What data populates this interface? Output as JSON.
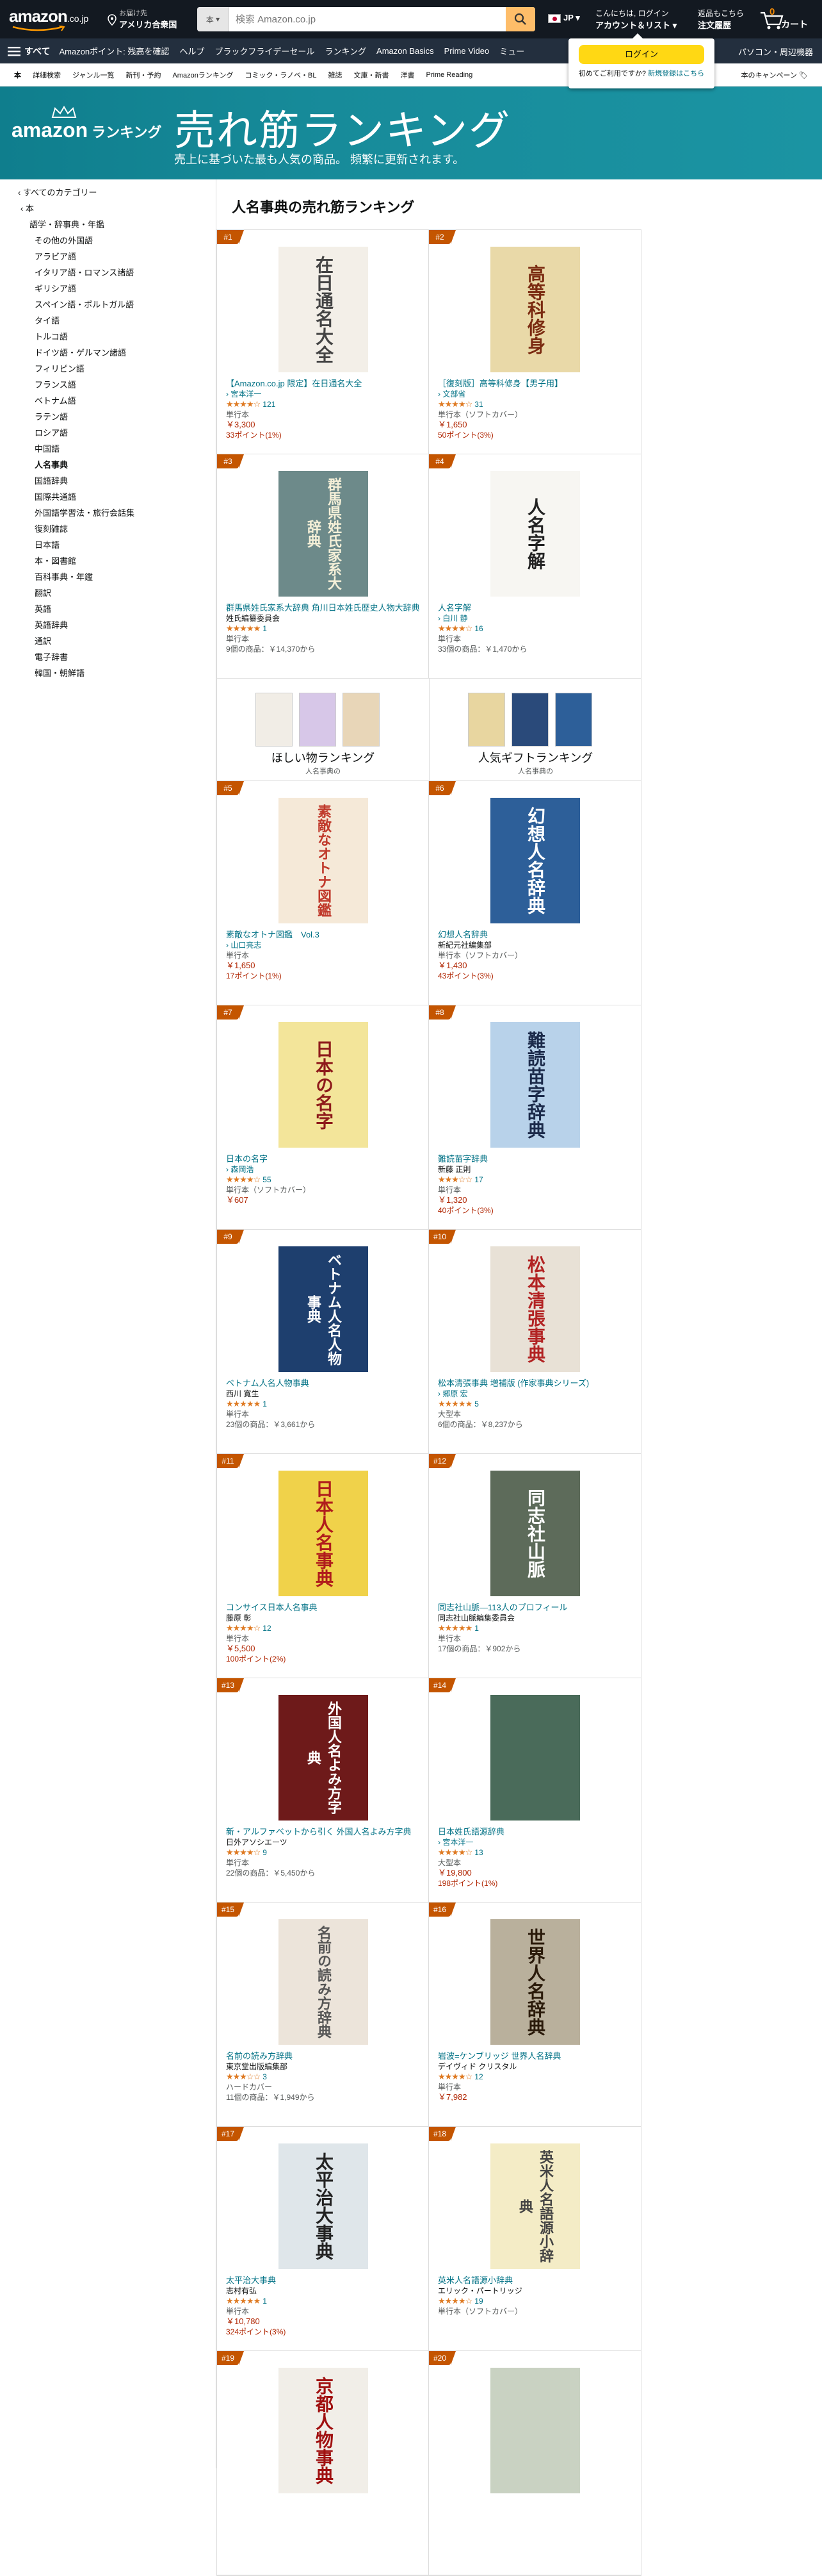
{
  "nav": {
    "logo": "amazon",
    "logo_suffix": ".co.jp",
    "deliver_l1": "お届け先",
    "deliver_l2": "アメリカ合衆国",
    "search_category": "本",
    "search_placeholder": "検索 Amazon.co.jp",
    "lang": "JP",
    "account_l1": "こんにちは, ログイン",
    "account_l2": "アカウント＆リスト",
    "orders_l1": "返品もこちら",
    "orders_l2": "注文履歴",
    "cart_count": "0",
    "cart_label": "カート"
  },
  "subnav": {
    "all": "すべて",
    "items": [
      "Amazonポイント: 残高を確認",
      "ヘルプ",
      "ブラックフライデーセール",
      "ランキング",
      "Amazon Basics",
      "Prime Video",
      "ミュー"
    ],
    "right": "パソコン・周辺機器"
  },
  "flyout": {
    "button": "ログイン",
    "text": "初めてご利用ですか?",
    "link": "新規登録はこちら"
  },
  "deptnav": {
    "items": [
      "本",
      "詳細検索",
      "ジャンル一覧",
      "新刊・予約",
      "Amazonランキング",
      "コミック・ラノベ・BL",
      "雑誌",
      "文庫・新書",
      "洋書",
      "Prime Reading"
    ],
    "right": "本のキャンペーン"
  },
  "banner": {
    "logo_word": "amazon",
    "logo_rank": "ランキング",
    "title": "売れ筋ランキング",
    "subtitle": "売上に基づいた最も人気の商品。 頻繁に更新されます。"
  },
  "sidebar": [
    {
      "label": "‹ すべてのカテゴリー",
      "d": 0
    },
    {
      "label": "‹ 本",
      "d": 1
    },
    {
      "label": "語学・辞事典・年鑑",
      "d": 2
    },
    {
      "label": "その他の外国語",
      "d": 3
    },
    {
      "label": "アラビア語",
      "d": 3
    },
    {
      "label": "イタリア語・ロマンス諸語",
      "d": 3
    },
    {
      "label": "ギリシア語",
      "d": 3
    },
    {
      "label": "スペイン語・ポルトガル語",
      "d": 3
    },
    {
      "label": "タイ語",
      "d": 3
    },
    {
      "label": "トルコ語",
      "d": 3
    },
    {
      "label": "ドイツ語・ゲルマン諸語",
      "d": 3
    },
    {
      "label": "フィリピン語",
      "d": 3
    },
    {
      "label": "フランス語",
      "d": 3
    },
    {
      "label": "ベトナム語",
      "d": 3
    },
    {
      "label": "ラテン語",
      "d": 3
    },
    {
      "label": "ロシア語",
      "d": 3
    },
    {
      "label": "中国語",
      "d": 3
    },
    {
      "label": "人名事典",
      "d": 3,
      "sel": true
    },
    {
      "label": "国語辞典",
      "d": 3
    },
    {
      "label": "国際共通語",
      "d": 3
    },
    {
      "label": "外国語学習法・旅行会話集",
      "d": 3
    },
    {
      "label": "復刻雑誌",
      "d": 3
    },
    {
      "label": "日本語",
      "d": 3
    },
    {
      "label": "本・図書館",
      "d": 3
    },
    {
      "label": "百科事典・年鑑",
      "d": 3
    },
    {
      "label": "翻訳",
      "d": 3
    },
    {
      "label": "英語",
      "d": 3
    },
    {
      "label": "英語辞典",
      "d": 3
    },
    {
      "label": "通訳",
      "d": 3
    },
    {
      "label": "電子辞書",
      "d": 3
    },
    {
      "label": "韓国・朝鮮語",
      "d": 3
    }
  ],
  "heading": "人名事典の売れ筋ランキング",
  "products": [
    {
      "rank": "#1",
      "title": "【Amazon.co.jp 限定】在日通名大全",
      "author": "› 宮本洋一",
      "author_link": true,
      "stars": "★★★★☆",
      "rating": 4.0,
      "count": "121",
      "format": "単行本",
      "price": "￥3,300",
      "points": "33ポイント(1%)",
      "offers": "",
      "cover_text": "在日通名大全",
      "cover_bg": "#f3efe8",
      "cover_fg": "#444"
    },
    {
      "rank": "#2",
      "title": "［復刻版］高等科修身【男子用】",
      "author": "› 文部省",
      "author_link": true,
      "stars": "★★★★☆",
      "rating": 4.4,
      "count": "31",
      "format": "単行本（ソフトカバー）",
      "price": "￥1,650",
      "points": "50ポイント(3%)",
      "offers": "",
      "cover_text": "高等科修身",
      "cover_bg": "#e9d9a8",
      "cover_fg": "#7a2a10"
    },
    {
      "rank": "#3",
      "title": "群馬県姓氏家系大辞典 角川日本姓氏歴史人物大辞典",
      "author": "姓氏編纂委員会",
      "author_link": false,
      "stars": "★★★★★",
      "rating": 5.0,
      "count": "1",
      "format": "単行本",
      "price": "",
      "points": "",
      "offers": "9個の商品：￥14,370から",
      "cover_text": "群馬県姓氏家系大辞典",
      "cover_bg": "#6d8a8a",
      "cover_fg": "#f5f0d8"
    },
    {
      "rank": "#4",
      "title": "人名字解",
      "author": "› 白川 静",
      "author_link": true,
      "stars": "★★★★☆",
      "rating": 4.4,
      "count": "16",
      "format": "単行本",
      "price": "",
      "points": "",
      "offers": "33個の商品：￥1,470から",
      "cover_text": "人名字解",
      "cover_bg": "#f7f6f2",
      "cover_fg": "#222"
    },
    {
      "rank": "#5",
      "title": "素敵なオトナ図鑑　Vol.3",
      "author": "› 山口亮志",
      "author_link": true,
      "stars": "",
      "rating": 0,
      "count": "",
      "format": "単行本",
      "price": "￥1,650",
      "points": "17ポイント(1%)",
      "offers": "",
      "cover_text": "素敵なオトナ図鑑",
      "cover_bg": "#f5e9d8",
      "cover_fg": "#c0392b"
    },
    {
      "rank": "#6",
      "title": "幻想人名辞典",
      "author": "新紀元社編集部",
      "author_link": false,
      "stars": "",
      "rating": 0,
      "count": "",
      "format": "単行本（ソフトカバー）",
      "price": "￥1,430",
      "points": "43ポイント(3%)",
      "offers": "",
      "cover_text": "幻想人名辞典",
      "cover_bg": "#2d5f99",
      "cover_fg": "#ffffff"
    },
    {
      "rank": "#7",
      "title": "日本の名字",
      "author": "› 森岡浩",
      "author_link": true,
      "stars": "★★★★☆",
      "rating": 4.3,
      "count": "55",
      "format": "単行本（ソフトカバー）",
      "price": "￥607",
      "points": "",
      "offers": "",
      "cover_text": "日本の名字",
      "cover_bg": "#f3e59a",
      "cover_fg": "#8e1b1b"
    },
    {
      "rank": "#8",
      "title": "難読苗字辞典",
      "author": "新藤 正則",
      "author_link": false,
      "stars": "★★★☆☆",
      "rating": 3.4,
      "count": "17",
      "format": "単行本",
      "price": "￥1,320",
      "points": "40ポイント(3%)",
      "offers": "",
      "cover_text": "難読苗字辞典",
      "cover_bg": "#b8d2ea",
      "cover_fg": "#1b2a4a"
    },
    {
      "rank": "#9",
      "title": "ベトナム人名人物事典",
      "author": "西川 寛生",
      "author_link": false,
      "stars": "★★★★★",
      "rating": 5.0,
      "count": "1",
      "format": "単行本",
      "price": "",
      "points": "",
      "offers": "23個の商品：￥3,661から",
      "cover_text": "ベトナム人名人物事典",
      "cover_bg": "#1e3f6e",
      "cover_fg": "#ffffff"
    },
    {
      "rank": "#10",
      "title": "松本清張事典 増補版 (作家事典シリーズ)",
      "author": "› 郷原 宏",
      "author_link": true,
      "stars": "★★★★★",
      "rating": 5.0,
      "count": "5",
      "format": "大型本",
      "price": "",
      "points": "",
      "offers": "6個の商品：￥8,237から",
      "cover_text": "松本清張事典",
      "cover_bg": "#e8e1d6",
      "cover_fg": "#b22222"
    },
    {
      "rank": "#11",
      "title": "コンサイス日本人名事典",
      "author": "藤原 彰",
      "author_link": false,
      "stars": "★★★★☆",
      "rating": 4.2,
      "count": "12",
      "format": "単行本",
      "price": "￥5,500",
      "points": "100ポイント(2%)",
      "offers": "",
      "cover_text": "日本人名事典",
      "cover_bg": "#f0d24a",
      "cover_fg": "#b01c1c"
    },
    {
      "rank": "#12",
      "title": "同志社山脈―113人のプロフィール",
      "author": "同志社山脈編集委員会",
      "author_link": false,
      "stars": "★★★★★",
      "rating": 5.0,
      "count": "1",
      "format": "単行本",
      "price": "",
      "points": "",
      "offers": "17個の商品：￥902から",
      "cover_text": "同志社山脈",
      "cover_bg": "#5d6b5a",
      "cover_fg": "#ffffff"
    },
    {
      "rank": "#13",
      "title": "新・アルファベットから引く 外国人名よみ方字典",
      "author": "日外アソシエーツ",
      "author_link": false,
      "stars": "★★★★☆",
      "rating": 4.4,
      "count": "9",
      "format": "単行本",
      "price": "",
      "points": "",
      "offers": "22個の商品：￥5,450から",
      "cover_text": "外国人名よみ方字典",
      "cover_bg": "#6e1a1a",
      "cover_fg": "#ffffff"
    },
    {
      "rank": "#14",
      "title": "日本姓氏語源辞典",
      "author": "› 宮本洋一",
      "author_link": true,
      "stars": "★★★★☆",
      "rating": 3.9,
      "count": "13",
      "format": "大型本",
      "price": "￥19,800",
      "points": "198ポイント(1%)",
      "offers": "",
      "cover_text": "",
      "cover_bg": "#4a6b5a",
      "cover_fg": "#ffffff"
    },
    {
      "rank": "#15",
      "title": "名前の読み方辞典",
      "author": "東京堂出版編集部",
      "author_link": false,
      "stars": "★★★☆☆",
      "rating": 3.2,
      "count": "3",
      "format": "ハードカバー",
      "price": "",
      "points": "",
      "offers": "11個の商品：￥1,949から",
      "cover_text": "名前の読み方辞典",
      "cover_bg": "#ece4da",
      "cover_fg": "#555"
    },
    {
      "rank": "#16",
      "title": "岩波=ケンブリッジ 世界人名辞典",
      "author": "デイヴィド クリスタル",
      "author_link": false,
      "stars": "★★★★☆",
      "rating": 4.1,
      "count": "12",
      "format": "単行本",
      "price": "￥7,982",
      "points": "",
      "offers": "",
      "cover_text": "世界人名辞典",
      "cover_bg": "#b9b09c",
      "cover_fg": "#2a1a0a"
    },
    {
      "rank": "#17",
      "title": "太平治大事典",
      "author": "志村有弘",
      "author_link": false,
      "stars": "★★★★★",
      "rating": 5.0,
      "count": "1",
      "format": "単行本",
      "price": "￥10,780",
      "points": "324ポイント(3%)",
      "offers": "",
      "cover_text": "太平治大事典",
      "cover_bg": "#dfe6ea",
      "cover_fg": "#222"
    },
    {
      "rank": "#18",
      "title": "英米人名語源小辞典",
      "author": "エリック・パートリッジ",
      "author_link": false,
      "stars": "★★★★☆",
      "rating": 4.0,
      "count": "19",
      "format": "単行本（ソフトカバー）",
      "price": "",
      "points": "",
      "offers": "",
      "cover_text": "英米人名語源小辞典",
      "cover_bg": "#f4ecc6",
      "cover_fg": "#444"
    },
    {
      "rank": "#19",
      "title": "",
      "author": "",
      "author_link": false,
      "stars": "",
      "rating": 0,
      "count": "",
      "format": "",
      "price": "",
      "points": "",
      "offers": "",
      "cover_text": "京都人物事典",
      "cover_bg": "#f1eee8",
      "cover_fg": "#a01010"
    },
    {
      "rank": "#20",
      "title": "",
      "author": "",
      "author_link": false,
      "stars": "",
      "rating": 0,
      "count": "",
      "format": "",
      "price": "",
      "points": "",
      "offers": "",
      "cover_text": "",
      "cover_bg": "#c9d2c2",
      "cover_fg": "#222"
    }
  ],
  "promo": [
    {
      "title": "ほしい物ランキング",
      "sub": "人名事典の"
    },
    {
      "title": "人気ギフトランキング",
      "sub": "人名事典の"
    }
  ]
}
